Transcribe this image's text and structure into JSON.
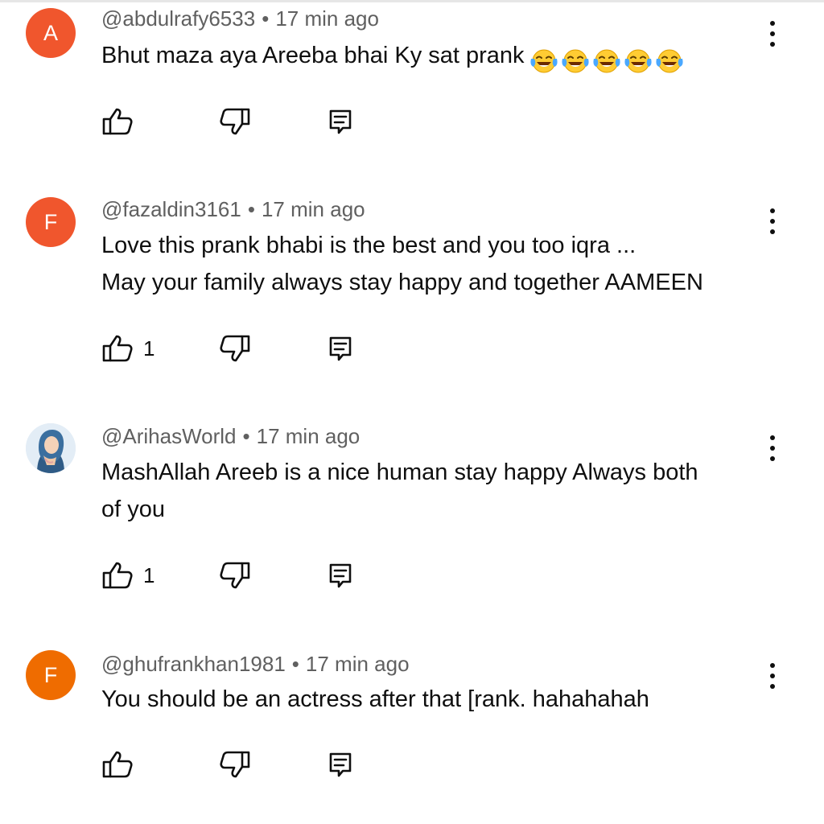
{
  "colors": {
    "avatar_red": "#f0562d",
    "avatar_orange": "#ef6c00",
    "meta_text": "#606060",
    "body_text": "#0f0f0f"
  },
  "icons": [
    "like-icon",
    "dislike-icon",
    "reply-icon",
    "more-vert-icon",
    "laughing-tears-emoji"
  ],
  "comments": [
    {
      "avatar_letter": "A",
      "avatar_color": "#f0562d",
      "author": "@abdulrafy6533",
      "separator": "•",
      "time": "17 min ago",
      "lines": [
        "Bhut maza aya Areeba bhai Ky sat prank"
      ],
      "emoji_count": 5,
      "likes": ""
    },
    {
      "avatar_letter": "F",
      "avatar_color": "#f0562d",
      "author": "@fazaldin3161",
      "separator": "•",
      "time": "17 min ago",
      "lines": [
        "Love this prank bhabi is the best and you too iqra ...",
        "May your family always stay happy and together AAMEEN"
      ],
      "likes": "1"
    },
    {
      "avatar_letter": "",
      "avatar_image": "profile-photo",
      "author": "@ArihasWorld",
      "separator": "•",
      "time": "17 min ago",
      "lines": [
        "MashAllah Areeb is a nice human stay happy Always both",
        "of you"
      ],
      "likes": "1"
    },
    {
      "avatar_letter": "F",
      "avatar_color": "#ef6c00",
      "author": "@ghufrankhan1981",
      "separator": "•",
      "time": "17 min ago",
      "lines": [
        "You should be an actress after that [rank. hahahahah"
      ],
      "likes": ""
    }
  ]
}
